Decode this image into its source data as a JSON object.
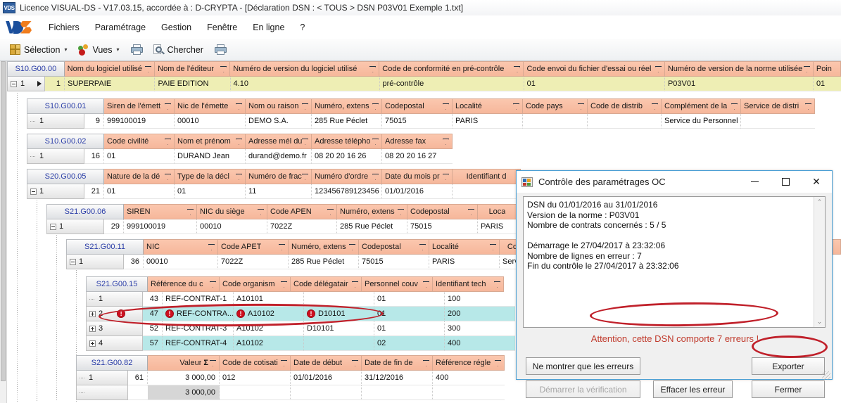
{
  "window": {
    "icon": "app-icon",
    "title": "Licence VISUAL-DS - V17.03.15, accordée à : D-CRYPTA - [Déclaration DSN :  < TOUS >  DSN P03V01 Exemple 1.txt]"
  },
  "menubar": {
    "logo": "vds-logo",
    "items": [
      {
        "label": "Fichiers"
      },
      {
        "label": "Paramétrage"
      },
      {
        "label": "Gestion"
      },
      {
        "label": "Fenêtre"
      },
      {
        "label": "En ligne"
      },
      {
        "label": "?"
      }
    ]
  },
  "toolbar": {
    "selection_label": "Sélection",
    "vues_label": "Vues",
    "chercher_label": "Chercher",
    "caret": "▾"
  },
  "grid": {
    "bands": [
      {
        "tag": "S10.G00.00",
        "columns": [
          "Nom du logiciel utilisé",
          "Nom de l'éditeur",
          "Numéro de version du logiciel utilisé",
          "Code de conformité en pré-contrôle",
          "Code envoi du fichier d'essai ou réel",
          "Numéro de version de la norme utilisée",
          "Poin"
        ],
        "rows": [
          {
            "index": "1",
            "seq": "1",
            "cells": [
              "SUPERPAIE",
              "PAIE EDITION",
              "4.10",
              "pré-contrôle",
              "01",
              "P03V01",
              "01"
            ]
          }
        ]
      },
      {
        "tag": "S10.G00.01",
        "columns": [
          "Siren de l'émett",
          "Nic de l'émette",
          "Nom ou raison",
          "Numéro, extens",
          "Codepostal",
          "Localité",
          "Code pays",
          "Code de distrib",
          "Complément de la",
          "Service de distri"
        ],
        "rows": [
          {
            "index": "1",
            "seq": "9",
            "cells": [
              "999100019",
              "00010",
              "DEMO S.A.",
              "285 Rue Péclet",
              "75015",
              "PARIS",
              "",
              "",
              "Service du Personnel",
              ""
            ]
          }
        ]
      },
      {
        "tag": "S10.G00.02",
        "columns": [
          "Code civilité",
          "Nom et prénom",
          "Adresse mél du",
          "Adresse télépho",
          "Adresse fax"
        ],
        "rows": [
          {
            "index": "1",
            "seq": "16",
            "cells": [
              "01",
              "DURAND Jean",
              "durand@demo.fr",
              "08 20 20 16 26",
              "08 20 20 16 27"
            ]
          }
        ]
      },
      {
        "tag": "S20.G00.05",
        "columns": [
          "Nature de la dé",
          "Type de la décl",
          "Numéro de frac",
          "Numéro d'ordre",
          "Date du mois pr",
          "Identifiant d"
        ],
        "rows": [
          {
            "index": "1",
            "seq": "21",
            "cells": [
              "01",
              "01",
              "11",
              "123456789123456",
              "01/01/2016",
              ""
            ]
          }
        ]
      },
      {
        "tag": "S21.G00.06",
        "columns": [
          "SIREN",
          "NIC du siège",
          "Code APEN",
          "Numéro, extens",
          "Codepostal",
          "Loca"
        ],
        "rows": [
          {
            "index": "1",
            "seq": "29",
            "cells": [
              "999100019",
              "00010",
              "7022Z",
              "285 Rue Péclet",
              "75015",
              "PARIS"
            ]
          }
        ]
      },
      {
        "tag": "S21.G00.11",
        "columns": [
          "NIC",
          "Code APET",
          "Numéro, extens",
          "Codepostal",
          "Localité",
          "Com"
        ],
        "rows": [
          {
            "index": "1",
            "seq": "36",
            "cells": [
              "00010",
              "7022Z",
              "285 Rue Péclet",
              "75015",
              "PARIS",
              "Serv"
            ]
          }
        ]
      },
      {
        "tag": "S21.G00.15",
        "columns": [
          "Référence du c",
          "Code organism",
          "Code délégatair",
          "Personnel couv",
          "Identifiant tech"
        ],
        "rows": [
          {
            "index": "1",
            "seq": "43",
            "cells": [
              "REF-CONTRAT-1",
              "A10101",
              "",
              "01",
              "100"
            ],
            "errors": [],
            "selected": false,
            "expandable": false
          },
          {
            "index": "2",
            "seq": "47",
            "cells": [
              "REF-CONTRA...",
              "A10102",
              "D10101",
              "01",
              "200"
            ],
            "errors": [
              0,
              1,
              2
            ],
            "row_error": true,
            "selected": true,
            "expandable": true
          },
          {
            "index": "3",
            "seq": "52",
            "cells": [
              "REF-CONTRAT-3",
              "A10102",
              "D10101",
              "01",
              "300"
            ],
            "errors": [],
            "selected": false,
            "expandable": true
          },
          {
            "index": "4",
            "seq": "57",
            "cells": [
              "REF-CONTRAT-4",
              "A10102",
              "",
              "02",
              "400"
            ],
            "errors": [],
            "selected": true,
            "expandable": true
          }
        ]
      },
      {
        "tag": "S21.G00.82",
        "columns": [
          "Valeur",
          "Code de cotisati",
          "Date de début",
          "Date de fin de",
          "Référence régle"
        ],
        "rows": [
          {
            "index": "1",
            "seq": "61",
            "cells": [
              "3 000,00",
              "012",
              "01/01/2016",
              "31/12/2016",
              "400"
            ]
          }
        ],
        "footer": {
          "total": "3 000,00"
        },
        "sigma": "Σ"
      }
    ],
    "right_fragments": {
      "code_pays_partial": "ay"
    }
  },
  "dialog": {
    "icon": "app-window-icon",
    "title": "Contrôle des paramétrages OC",
    "controls": {
      "minimize": "minimize-icon",
      "maximize": "maximize-icon",
      "close": "✕"
    },
    "log": "DSN du 01/01/2016 au 31/01/2016\nVersion de la norme : P03V01\nNombre de contrats concernés : 5 / 5\n\nDémarrage le 27/04/2017 à 23:32:06\nNombre de lignes en erreur : 7\nFin du contrôle le 27/04/2017 à 23:32:06",
    "scroll": {
      "up": "⌃",
      "down": "⌄"
    },
    "warning": "Attention, cette DSN comporte 7 erreurs !",
    "buttons": {
      "show_errors_only": "Ne montrer que les erreurs",
      "start_verification": "Démarrer la vérification",
      "clear_errors": "Effacer les erreur",
      "export": "Exporter",
      "close": "Fermer"
    }
  },
  "colors": {
    "header_orange": "#f6b79b",
    "tag_grey": "#dfe1e4",
    "selected_cyan": "#b7e8e8",
    "first_row_yellow": "#eeeeb4",
    "error_red": "#cf1020",
    "annotation_red": "#c0202a",
    "dialog_border_blue": "#4a9fd4",
    "tag_text_blue": "#2b3ea8"
  }
}
